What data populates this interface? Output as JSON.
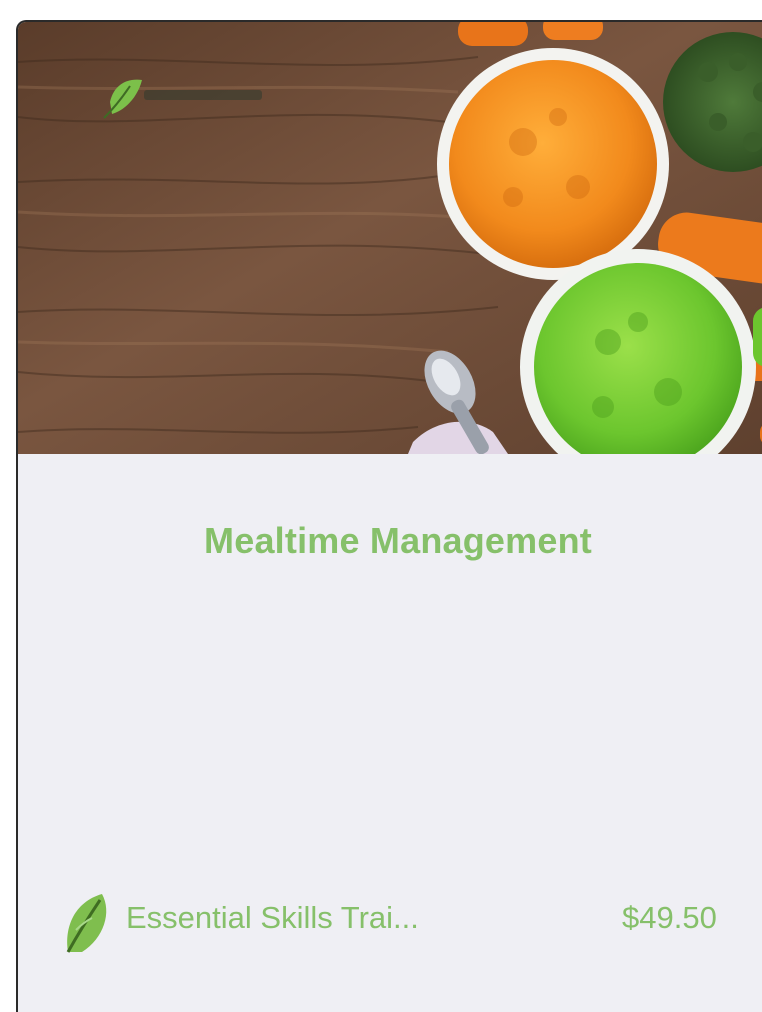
{
  "course": {
    "title": "Mealtime Management",
    "provider_name": "Essential Skills Trai...",
    "price": "$49.50",
    "image_alt": "Bowls of pureed carrot and pea on a wooden table",
    "logo_icon": "leaf-logo-icon"
  },
  "colors": {
    "accent": "#86c06a",
    "card_background": "#efeff4",
    "wood": "#6b4a35"
  }
}
